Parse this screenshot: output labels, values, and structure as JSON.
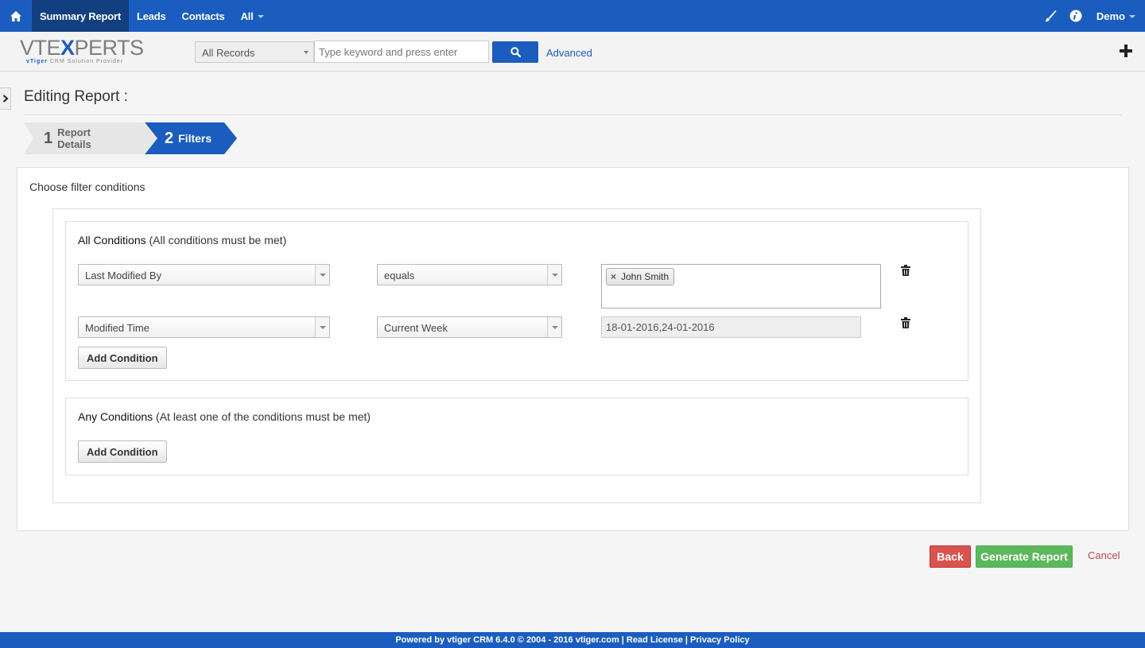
{
  "topnav": {
    "items": [
      {
        "label": "Summary Report"
      },
      {
        "label": "Leads"
      },
      {
        "label": "Contacts"
      },
      {
        "label": "All"
      }
    ],
    "user": "Demo"
  },
  "header": {
    "logo_main_1": "VTE",
    "logo_x": "X",
    "logo_main_2": "PERTS",
    "logo_sub_1": "vTiger",
    "logo_sub_2": " CRM Solution Provider",
    "records_select": "All Records",
    "search_placeholder": "Type keyword and press enter",
    "advanced": "Advanced"
  },
  "page": {
    "title": "Editing Report :",
    "steps": [
      {
        "num": "1",
        "label": "Report Details"
      },
      {
        "num": "2",
        "label": "Filters"
      }
    ],
    "heading": "Choose filter conditions"
  },
  "all_conditions": {
    "title": "All Conditions",
    "subtitle": " (All conditions must be met)",
    "rows": [
      {
        "field": "Last Modified By",
        "operator": "equals",
        "value_chip": "John Smith"
      },
      {
        "field": "Modified Time",
        "operator": "Current Week",
        "value_text": "18-01-2016,24-01-2016"
      }
    ],
    "add_label": "Add Condition"
  },
  "any_conditions": {
    "title": "Any Conditions",
    "subtitle": " (At least one of the conditions must be met)",
    "add_label": "Add Condition"
  },
  "actions": {
    "back": "Back",
    "generate": "Generate Report",
    "cancel": "Cancel"
  },
  "footer": {
    "text": "Powered by vtiger CRM 6.4.0  © 2004 - 2016  vtiger.com | Read License | Privacy Policy"
  },
  "colors": {
    "brand_blue": "#1b5dbe",
    "active_nav": "#123f80",
    "back_red": "#d9534f",
    "generate_green": "#5cb85c"
  }
}
